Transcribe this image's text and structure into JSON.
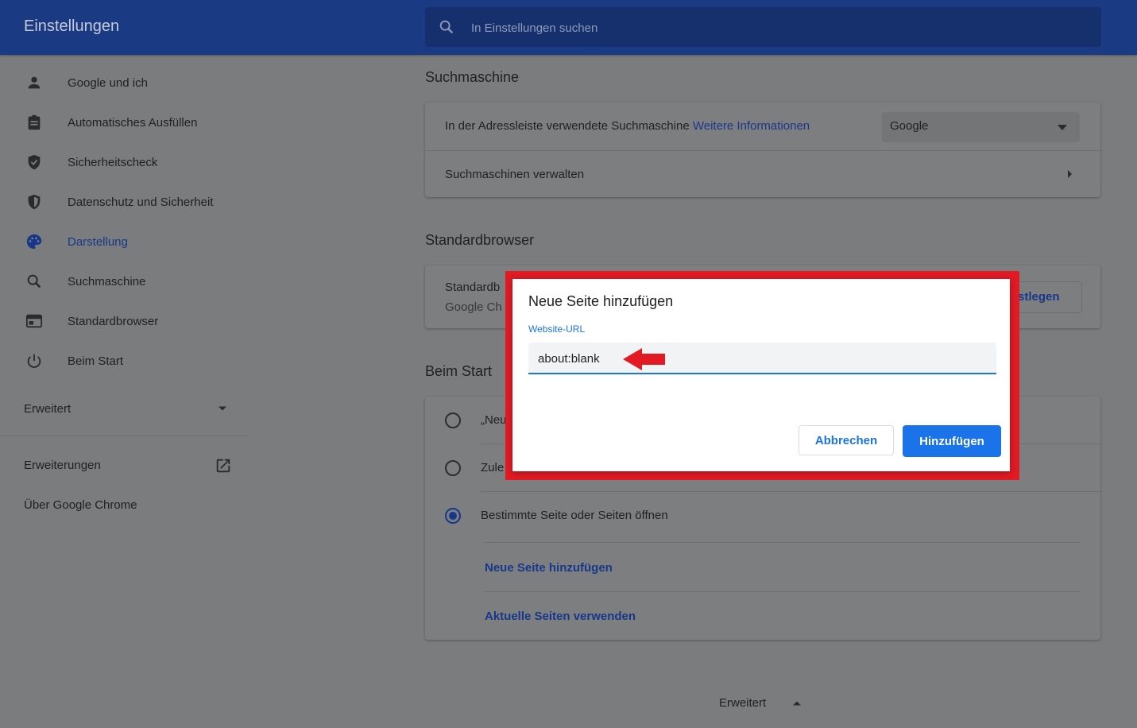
{
  "header": {
    "title": "Einstellungen",
    "search_placeholder": "In Einstellungen suchen"
  },
  "sidebar": {
    "items": [
      {
        "label": "Google und ich",
        "icon": "person-icon"
      },
      {
        "label": "Automatisches Ausfüllen",
        "icon": "clipboard-icon"
      },
      {
        "label": "Sicherheitscheck",
        "icon": "shield-check-icon"
      },
      {
        "label": "Datenschutz und Sicherheit",
        "icon": "shield-icon"
      },
      {
        "label": "Darstellung",
        "icon": "palette-icon",
        "active": true
      },
      {
        "label": "Suchmaschine",
        "icon": "search-icon"
      },
      {
        "label": "Standardbrowser",
        "icon": "browser-icon"
      },
      {
        "label": "Beim Start",
        "icon": "power-icon"
      }
    ],
    "advanced_label": "Erweitert",
    "extensions_label": "Erweiterungen",
    "about_label": "Über Google Chrome"
  },
  "search_engine": {
    "section_title": "Suchmaschine",
    "address_bar_text": "In der Adressleiste verwendete Suchmaschine",
    "more_info_link": "Weitere Informationen",
    "selected_engine": "Google",
    "manage_label": "Suchmaschinen verwalten"
  },
  "default_browser": {
    "section_title": "Standardbrowser",
    "title_partial": "Standardb",
    "sub_partial": "Google Ch",
    "button_partial": "stlegen"
  },
  "on_startup": {
    "section_title": "Beim Start",
    "option1_partial": "„Neu",
    "option2_partial": "Zule",
    "option3": "Bestimmte Seite oder Seiten öffnen",
    "add_page_link": "Neue Seite hinzufügen",
    "use_current_link": "Aktuelle Seiten verwenden"
  },
  "dialog": {
    "title": "Neue Seite hinzufügen",
    "field_label": "Website-URL",
    "url_value": "about:blank",
    "cancel_label": "Abbrechen",
    "add_label": "Hinzufügen",
    "frame_color": "#e21a24",
    "arrow_color": "#e21a24"
  },
  "footer": {
    "advanced_label": "Erweitert"
  }
}
